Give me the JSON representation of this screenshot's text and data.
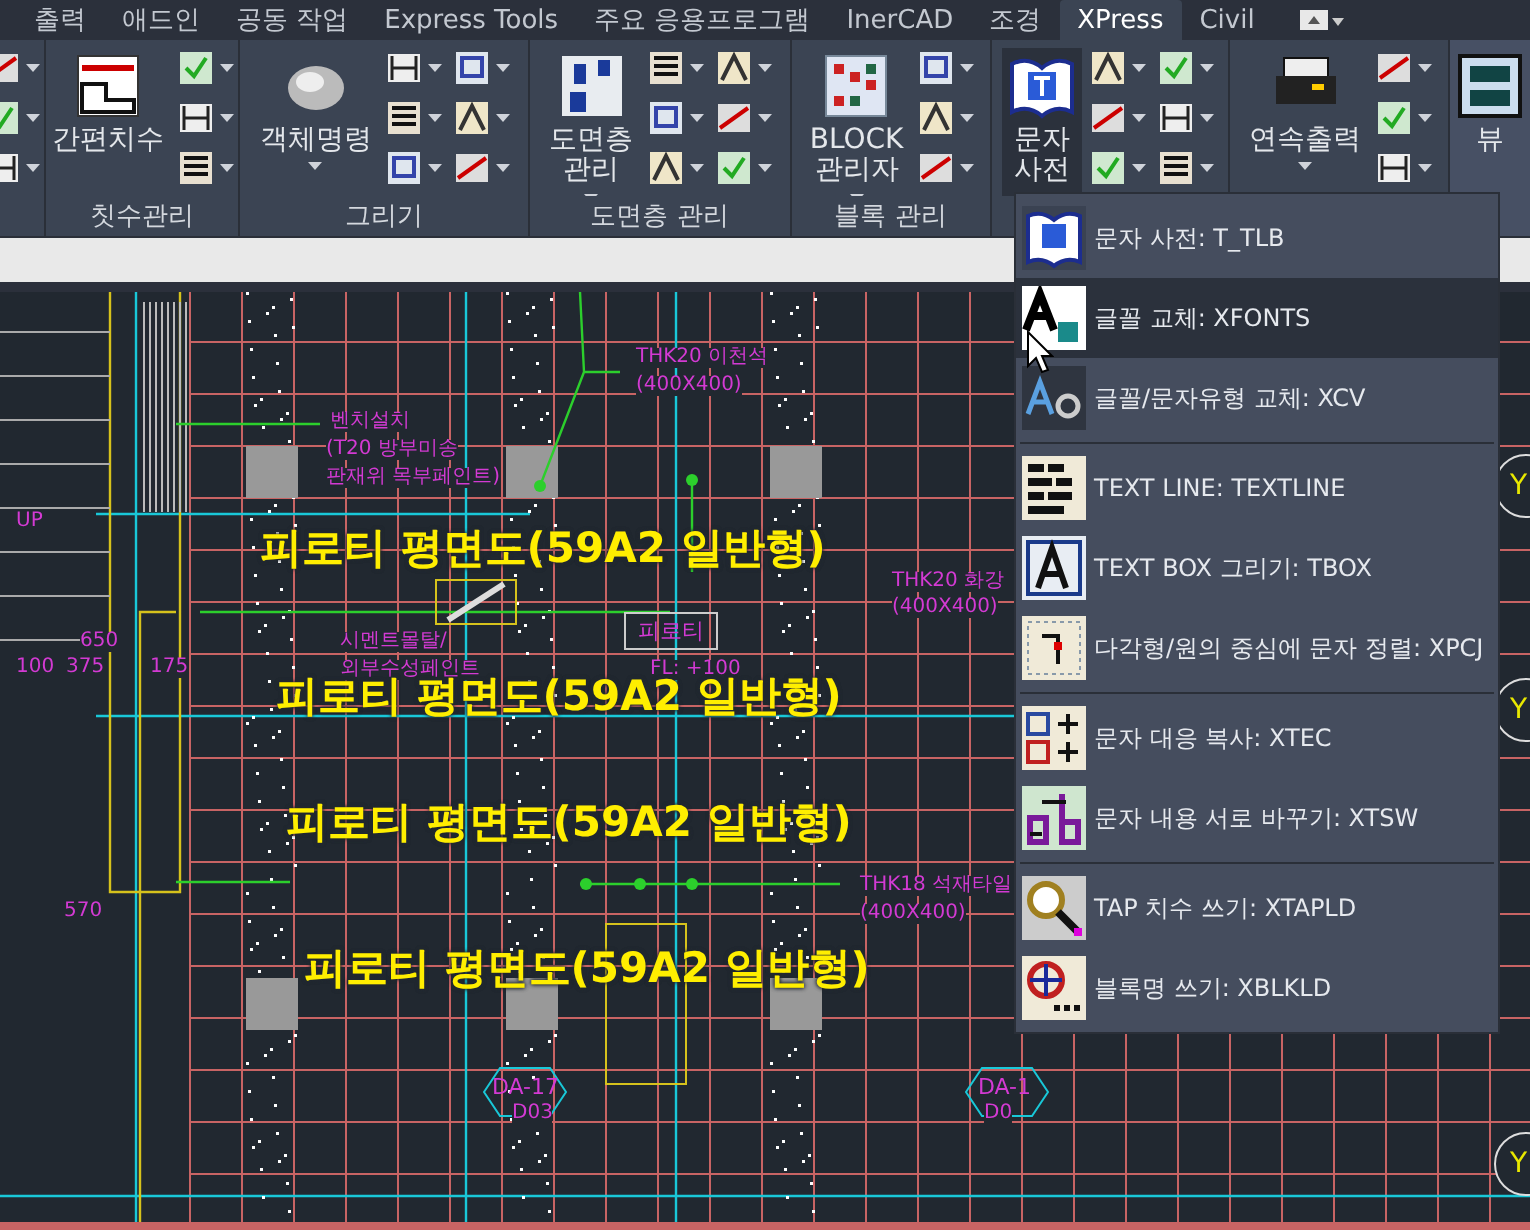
{
  "tabs": [
    {
      "label": "출력",
      "selected": false
    },
    {
      "label": "애드인",
      "selected": false
    },
    {
      "label": "공동 작업",
      "selected": false
    },
    {
      "label": "Express Tools",
      "selected": false
    },
    {
      "label": "주요 응용프로그램",
      "selected": false
    },
    {
      "label": "InerCAD",
      "selected": false
    },
    {
      "label": "조경",
      "selected": false
    },
    {
      "label": "XPress",
      "selected": true
    },
    {
      "label": "Civil",
      "selected": false
    }
  ],
  "panels": [
    {
      "kind": "cut"
    },
    {
      "kind": "one-column",
      "title": "칫수관리",
      "large_tool": {
        "label_lines": [
          "간편치수"
        ],
        "dropdown": false,
        "pressed": false
      }
    },
    {
      "kind": "two-column",
      "title": "그리기",
      "large_tool": {
        "label_lines": [
          "객체명령"
        ],
        "dropdown": true,
        "pressed": false
      }
    },
    {
      "kind": "two-column",
      "title": "도면층 관리",
      "large_tool": {
        "label_lines": [
          "도면층",
          "관리"
        ],
        "dropdown": true,
        "pressed": false
      }
    },
    {
      "kind": "one-column",
      "title": "블록 관리",
      "large_tool": {
        "label_lines": [
          "BLOCK",
          "관리자"
        ],
        "dropdown": true,
        "pressed": false
      }
    },
    {
      "kind": "two-column",
      "large_tool": {
        "label_lines": [
          "문자",
          "사전"
        ],
        "dropdown": true,
        "pressed": true
      }
    },
    {
      "kind": "one-column",
      "large_tool": {
        "label_lines": [
          "연속출력"
        ],
        "dropdown": true,
        "pressed": false
      }
    },
    {
      "kind": "cut",
      "large_tool": {
        "label_lines": [
          "뷰"
        ],
        "dropdown": false,
        "pressed": false
      }
    }
  ],
  "menu": {
    "groups": [
      [
        {
          "label": "문자 사전: T_TLB",
          "kind": "book",
          "selected": false
        },
        {
          "label": "글꼴 교체: XFONTS",
          "kind": "font-swap",
          "selected": true
        },
        {
          "label": "글꼴/문자유형 교체: XCV",
          "kind": "font-style",
          "selected": false
        }
      ],
      [
        {
          "label": "TEXT LINE: TEXTLINE",
          "kind": "text-line",
          "selected": false
        },
        {
          "label": "TEXT BOX 그리기: TBOX",
          "kind": "text-box",
          "selected": false
        },
        {
          "label": "다각형/원의 중심에 문자 정렬: XPCJ",
          "kind": "center-align",
          "selected": false
        }
      ],
      [
        {
          "label": "문자 대응 복사: XTEC",
          "kind": "copy",
          "selected": false
        },
        {
          "label": "문자 내용 서로 바꾸기: XTSW",
          "kind": "swap",
          "selected": false
        }
      ],
      [
        {
          "label": "TAP 치수 쓰기: XTAPLD",
          "kind": "tap-dimension",
          "selected": false
        },
        {
          "label": "블록명 쓰기: XBLKLD",
          "kind": "block-name",
          "selected": false
        }
      ]
    ]
  },
  "drawing": {
    "labels": [
      {
        "kind": "note",
        "text": "THK20 이천석"
      },
      {
        "kind": "note",
        "text": "(400X400)"
      },
      {
        "kind": "note",
        "text": "벤치설치"
      },
      {
        "kind": "note",
        "text": "(T20 방부미송"
      },
      {
        "kind": "note",
        "text": "판재위 목부페인트)"
      },
      {
        "kind": "note",
        "text": "UP"
      },
      {
        "kind": "dimension",
        "text": "650"
      },
      {
        "kind": "dimension",
        "text": "100"
      },
      {
        "kind": "dimension",
        "text": "375"
      },
      {
        "kind": "dimension",
        "text": "175"
      },
      {
        "kind": "title",
        "text": "피로티 평면도(59A2 일반형)"
      },
      {
        "kind": "note",
        "text": "THK20 화강"
      },
      {
        "kind": "note",
        "text": "(400X400)"
      },
      {
        "kind": "note",
        "text": "시멘트몰탈/"
      },
      {
        "kind": "note",
        "text": "외부수성페인트"
      },
      {
        "kind": "room-tag",
        "text": "피로티"
      },
      {
        "kind": "note",
        "text": "FL: +100"
      },
      {
        "kind": "title",
        "text": "피로티 평면도(59A2 일반형)"
      },
      {
        "kind": "title",
        "text": "피로티 평면도(59A2 일반형)"
      },
      {
        "kind": "dimension",
        "text": "570"
      },
      {
        "kind": "note",
        "text": "THK18 석재타일"
      },
      {
        "kind": "note",
        "text": "(400X400)"
      },
      {
        "kind": "title",
        "text": "피로티 평면도(59A2 일반형)"
      },
      {
        "kind": "hex-tag",
        "text": "DA-17"
      },
      {
        "kind": "note",
        "text": "D03"
      },
      {
        "kind": "hex-tag",
        "text": "DA-1"
      },
      {
        "kind": "note",
        "text": "D0"
      },
      {
        "kind": "grid-bubble",
        "text": "Y"
      },
      {
        "kind": "grid-bubble",
        "text": "Y"
      },
      {
        "kind": "grid-bubble",
        "text": "Y"
      }
    ]
  }
}
